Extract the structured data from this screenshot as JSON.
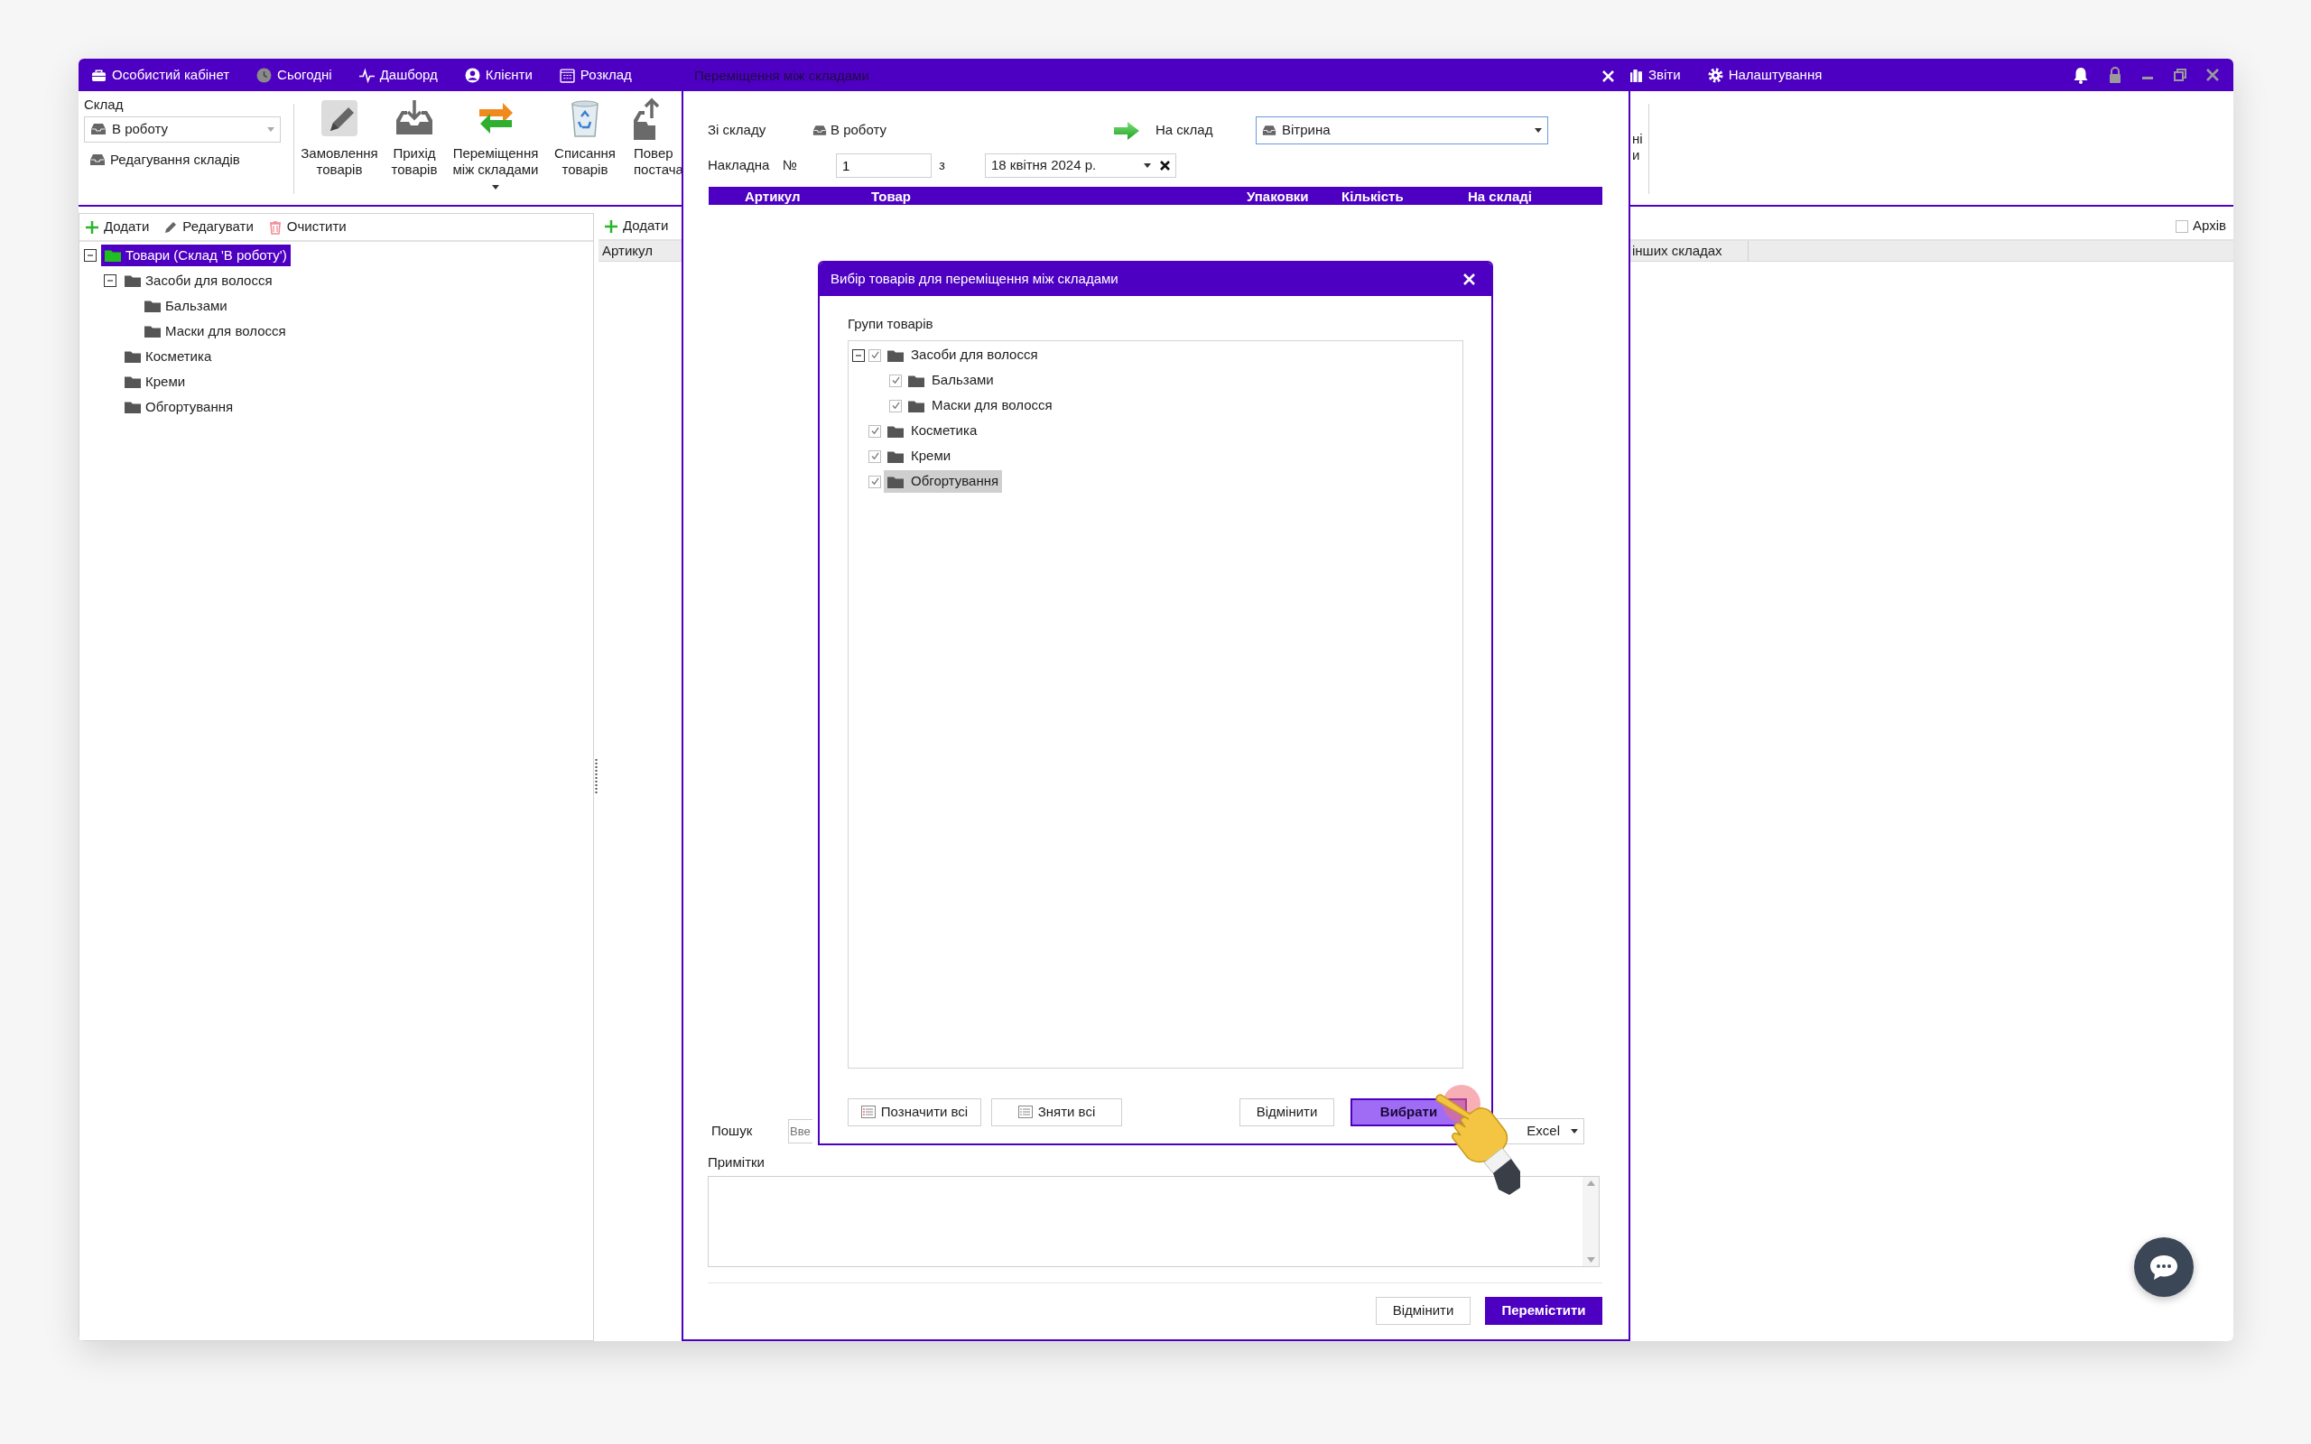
{
  "app": {
    "menu": [
      {
        "label": "Особистий кабінет"
      },
      {
        "label": "Сьогодні"
      },
      {
        "label": "Дашборд"
      },
      {
        "label": "Клієнти"
      },
      {
        "label": "Розклад"
      }
    ],
    "menu_right": [
      {
        "label": "Звіти"
      },
      {
        "label": "Налаштування"
      }
    ],
    "warehouse": {
      "label": "Склад",
      "value": "В роботу",
      "edit": "Редагування складів"
    },
    "ribbon": [
      {
        "lines": [
          "Замовлення",
          "товарів"
        ],
        "dropdown": false
      },
      {
        "lines": [
          "Прихід",
          "товарів"
        ],
        "dropdown": false
      },
      {
        "lines": [
          "Переміщення",
          "між складами"
        ],
        "dropdown": true
      },
      {
        "lines": [
          "Списання",
          "товарів"
        ],
        "dropdown": false
      },
      {
        "lines": [
          "Повер",
          "постача"
        ],
        "dropdown": false
      }
    ],
    "ribbon_right": [
      "ні",
      "и"
    ],
    "tree_toolbar": [
      "Додати",
      "Редагувати",
      "Очистити"
    ],
    "tree": [
      {
        "label": "Товари (Склад 'В роботу')",
        "selected": true,
        "children": [
          {
            "label": "Засоби для волосся",
            "selected": false,
            "children": [
              {
                "label": "Бальзами",
                "selected": false
              },
              {
                "label": "Маски для волосся",
                "selected": false
              }
            ]
          },
          {
            "label": "Косметика",
            "selected": false
          },
          {
            "label": "Креми",
            "selected": false
          },
          {
            "label": "Обгортування",
            "selected": false
          }
        ]
      }
    ],
    "list_toolbar": "Додати",
    "list_column": "Артикул",
    "archive": {
      "label": "Архів",
      "checked": false
    },
    "right_column": "інших складах"
  },
  "transfer_dialog": {
    "title": "Переміщення між складами",
    "from_label": "Зі складу",
    "from_value": "В роботу",
    "to_label": "На склад",
    "to_value": "Вітрина",
    "invoice_label": "Накладна",
    "number_label": "№",
    "number": "1",
    "date_label": "з",
    "date": "18 квітня 2024 р.",
    "columns": [
      "Артикул",
      "Товар",
      "Упаковки",
      "Кількість",
      "На складі"
    ],
    "search_label": "Пошук",
    "search": {
      "placeholder": "Вве"
    },
    "export": "Excel",
    "notes_label": "Примітки",
    "buttons": [
      {
        "label": "Відмінити",
        "kind": "cancel"
      },
      {
        "label": "Перемістити",
        "kind": "primary"
      }
    ]
  },
  "select_dialog": {
    "title": "Вибір товарів для переміщення між складами",
    "groups_label": "Групи товарів",
    "tree": [
      {
        "label": "Засоби для волосся",
        "checked": true,
        "selected": false,
        "children": [
          {
            "label": "Бальзами",
            "checked": true,
            "selected": false
          },
          {
            "label": "Маски для волосся",
            "checked": true,
            "selected": false
          }
        ]
      },
      {
        "label": "Косметика",
        "checked": true,
        "selected": false
      },
      {
        "label": "Креми",
        "checked": true,
        "selected": false
      },
      {
        "label": "Обгортування",
        "checked": true,
        "selected": true
      }
    ],
    "buttons": [
      {
        "label": "Позначити всі",
        "kind": "check-all"
      },
      {
        "label": "Зняти всі",
        "kind": "uncheck-all"
      },
      {
        "label": "Відмінити",
        "kind": "cancel"
      },
      {
        "label": "Вибрати",
        "kind": "confirm"
      }
    ]
  }
}
